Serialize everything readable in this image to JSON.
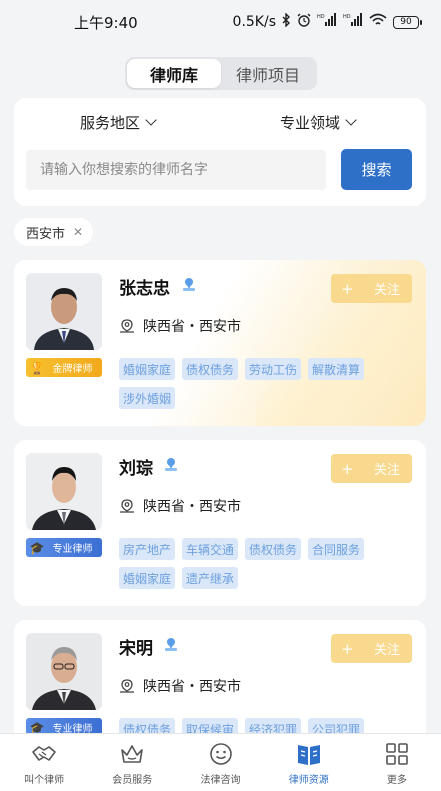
{
  "status_bar": {
    "time": "上午9:40",
    "speed": "0.5K/s",
    "battery": "90"
  },
  "tabs": [
    {
      "label": "律师库",
      "active": true
    },
    {
      "label": "律师项目",
      "active": false
    }
  ],
  "filters": {
    "region_label": "服务地区",
    "field_label": "专业领域",
    "search_placeholder": "请输入你想搜索的律师名字",
    "search_button": "搜索"
  },
  "active_chip": {
    "label": "西安市"
  },
  "follow_label": "关注",
  "lawyers": [
    {
      "name": "张志忠",
      "location": "陕西省・西安市",
      "badge": "金牌律师",
      "badge_type": "gold",
      "tags": [
        "婚姻家庭",
        "债权债务",
        "劳动工伤",
        "解散清算",
        "涉外婚姻"
      ]
    },
    {
      "name": "刘琮",
      "location": "陕西省・西安市",
      "badge": "专业律师",
      "badge_type": "pro",
      "tags": [
        "房产地产",
        "车辆交通",
        "债权债务",
        "合同服务",
        "婚姻家庭",
        "遗产继承"
      ]
    },
    {
      "name": "宋明",
      "location": "陕西省・西安市",
      "badge": "专业律师",
      "badge_type": "pro",
      "tags": [
        "债权债务",
        "取保候审",
        "经济犯罪",
        "公司犯罪"
      ]
    }
  ],
  "bottom_nav": [
    {
      "label": "叫个律师",
      "icon": "handshake-icon",
      "active": false
    },
    {
      "label": "会员服务",
      "icon": "crown-icon",
      "active": false
    },
    {
      "label": "法律咨询",
      "icon": "smiley-icon",
      "active": false
    },
    {
      "label": "律师资源",
      "icon": "book-icon",
      "active": true
    },
    {
      "label": "更多",
      "icon": "grid-icon",
      "active": false
    }
  ],
  "colors": {
    "accent": "#2e70c8",
    "follow": "#f9d98d",
    "tag_bg": "#d9e7f9",
    "tag_text": "#6ea0de"
  }
}
